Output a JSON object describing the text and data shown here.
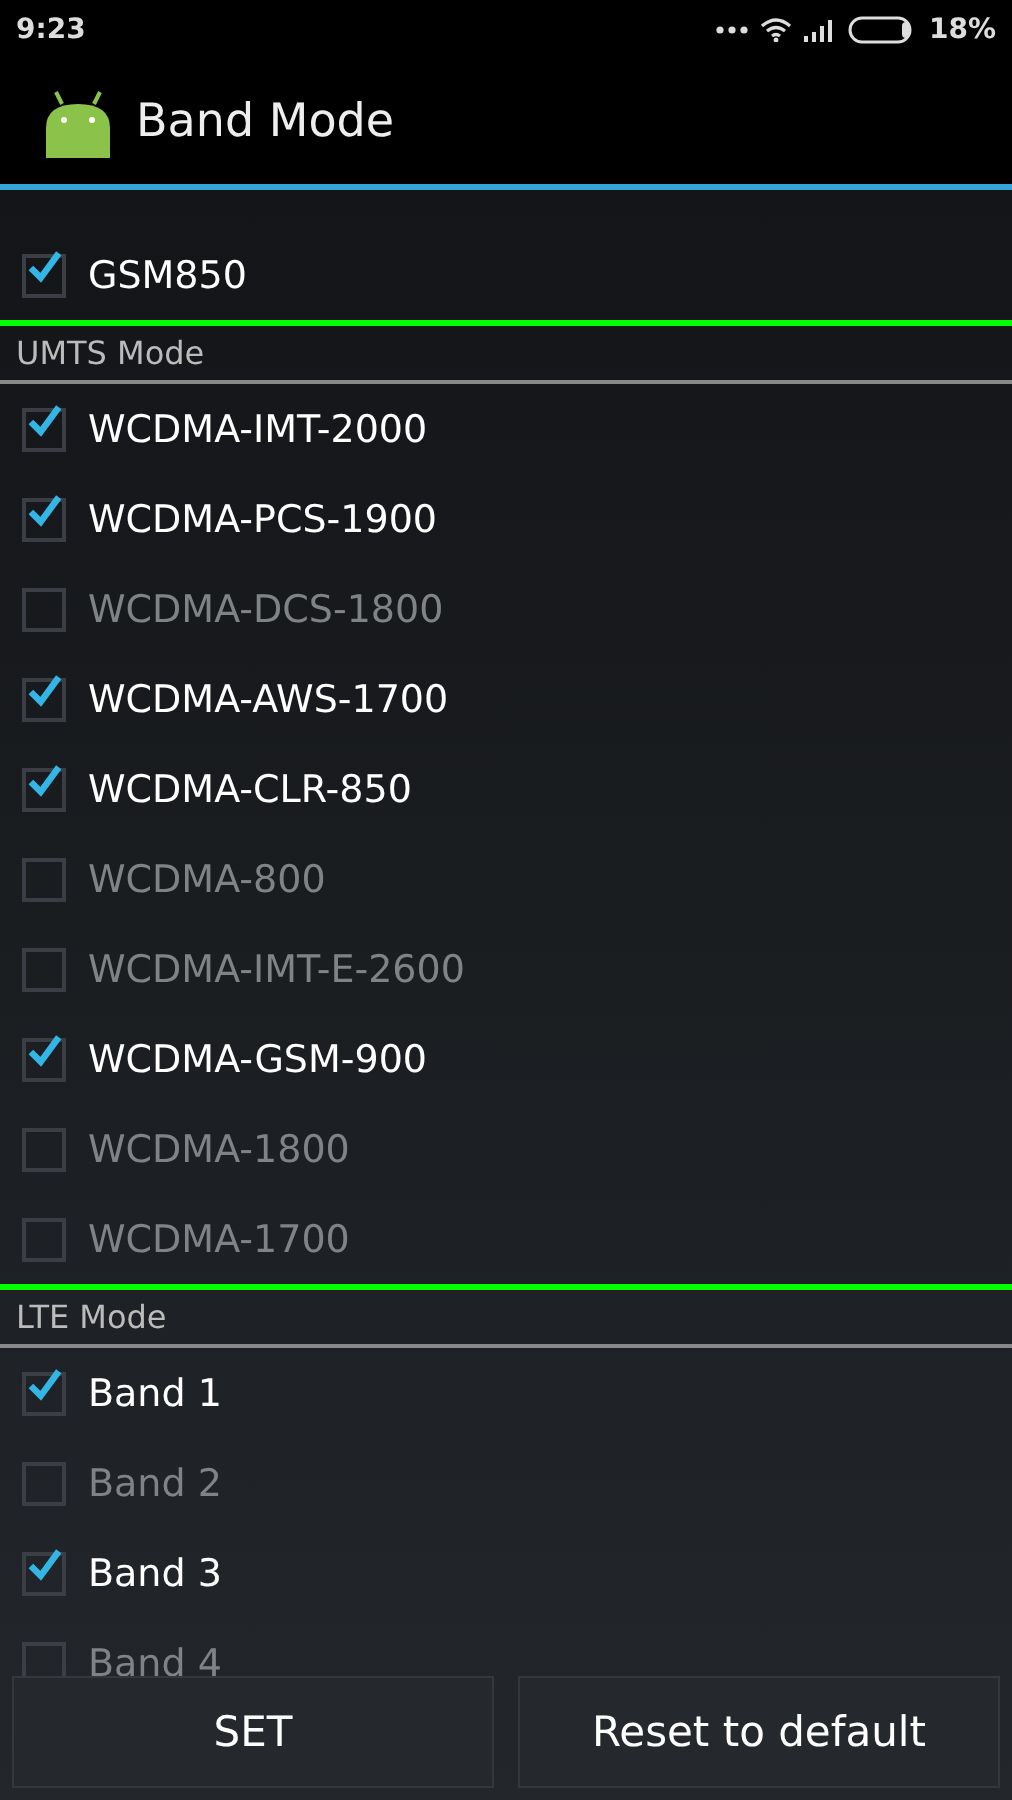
{
  "status_bar": {
    "time": "9:23",
    "battery": "18%"
  },
  "app_bar": {
    "title": "Band Mode"
  },
  "sections": [
    {
      "items": [
        {
          "label": "GSM850",
          "checked": true
        }
      ]
    },
    {
      "header": "UMTS Mode",
      "items": [
        {
          "label": "WCDMA-IMT-2000",
          "checked": true
        },
        {
          "label": "WCDMA-PCS-1900",
          "checked": true
        },
        {
          "label": "WCDMA-DCS-1800",
          "checked": false
        },
        {
          "label": "WCDMA-AWS-1700",
          "checked": true
        },
        {
          "label": "WCDMA-CLR-850",
          "checked": true
        },
        {
          "label": "WCDMA-800",
          "checked": false
        },
        {
          "label": "WCDMA-IMT-E-2600",
          "checked": false
        },
        {
          "label": "WCDMA-GSM-900",
          "checked": true
        },
        {
          "label": "WCDMA-1800",
          "checked": false
        },
        {
          "label": "WCDMA-1700",
          "checked": false
        }
      ]
    },
    {
      "header": "LTE Mode",
      "items": [
        {
          "label": "Band 1",
          "checked": true
        },
        {
          "label": "Band 2",
          "checked": false
        },
        {
          "label": "Band 3",
          "checked": true
        },
        {
          "label": "Band 4",
          "checked": false
        }
      ]
    }
  ],
  "buttons": [
    "SET",
    "Reset to default"
  ]
}
